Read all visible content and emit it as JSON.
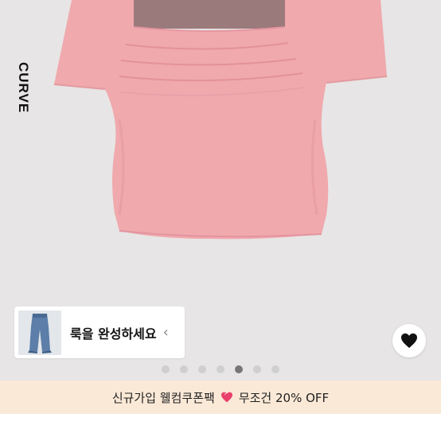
{
  "hero": {
    "side_label": "CURVE"
  },
  "look_card": {
    "text": "룩을 완성하세요",
    "chevron": "‹",
    "thumb_icon": "jeans-thumbnail"
  },
  "wishlist": {
    "icon": "heart-icon"
  },
  "pager": {
    "count": 7,
    "active_index": 4
  },
  "promo": {
    "left_text": "신규가입 웰컴쿠폰팩",
    "right_text": "무조건 20% OFF",
    "icon": "heart-gem-icon"
  },
  "colors": {
    "shirt_pink": "#f0a9ad",
    "background": "#e7e5e5",
    "promo_bg": "#fbe9d7",
    "heart_red": "#e9416b"
  }
}
